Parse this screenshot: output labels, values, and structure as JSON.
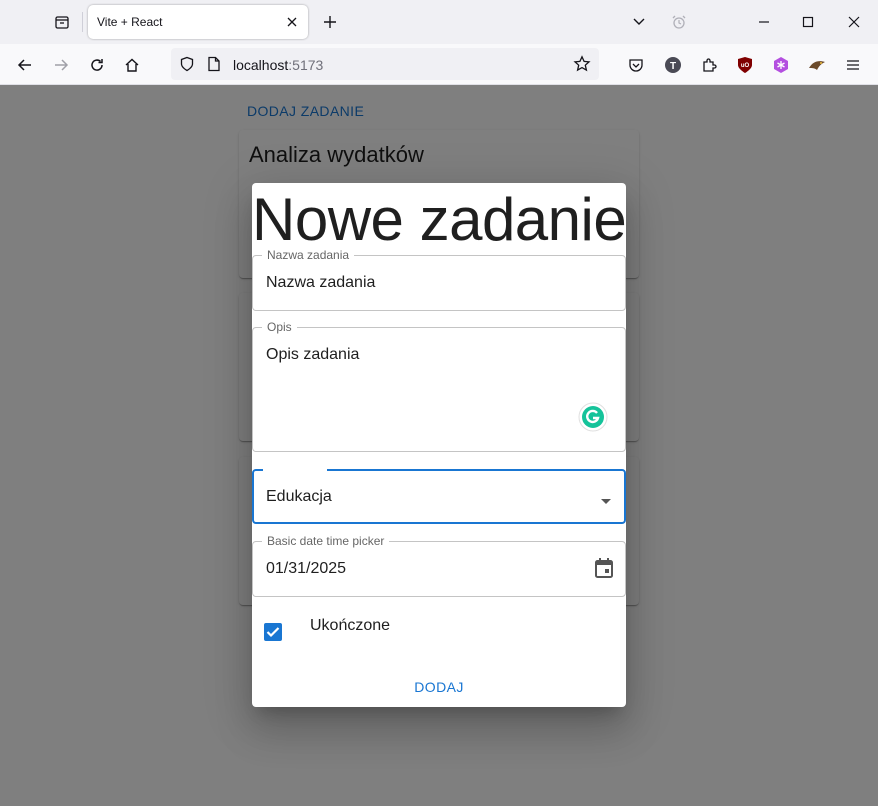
{
  "browser": {
    "tab_title": "Vite + React",
    "url_host": "localhost",
    "url_port": ":5173",
    "toolbar_icons": [
      "pocket-icon",
      "account-icon",
      "extensions-icon",
      "ublock-icon",
      "extension-icon",
      "extension-icon",
      "menu-icon"
    ]
  },
  "page": {
    "add_task_link": "DODAJ ZADANIE",
    "cards": [
      {
        "title": "Analiza wydatków"
      }
    ]
  },
  "dialog": {
    "title": "Nowe zadanie",
    "name_field": {
      "label": "Nazwa zadania",
      "value": "Nazwa zadania"
    },
    "description_field": {
      "label": "Opis",
      "value": "Opis zadania"
    },
    "category_select": {
      "value": "Edukacja"
    },
    "date_field": {
      "label": "Basic date time picker",
      "value": "01/31/2025"
    },
    "completed_checkbox": {
      "label": "Ukończone",
      "checked": true
    },
    "submit_button": "DODAJ"
  },
  "colors": {
    "accent": "#1976d2",
    "grammarly": "#15c39a"
  }
}
